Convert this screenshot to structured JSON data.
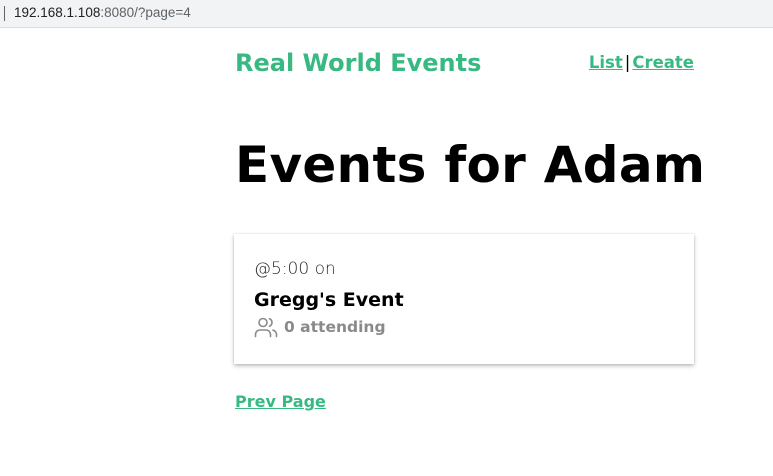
{
  "browser": {
    "url_host": "192.168.1.108",
    "url_rest": ":8080/?page=4"
  },
  "header": {
    "brand": "Real World Events",
    "nav_list": "List",
    "nav_separator": "|",
    "nav_create": "Create"
  },
  "main": {
    "title": "Events for Adam",
    "events": [
      {
        "time": "@5:00 on",
        "title": "Gregg's Event",
        "attending": "0 attending",
        "icon": "users-icon"
      }
    ],
    "prev_page": "Prev Page"
  },
  "colors": {
    "accent": "#39b982",
    "muted": "#8a8a8a"
  }
}
